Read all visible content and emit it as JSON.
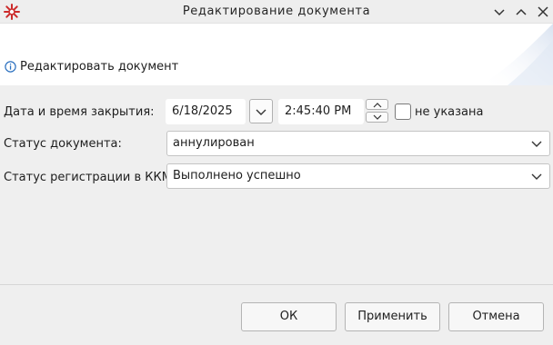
{
  "window": {
    "title": "Редактирование документа",
    "icon": "red-snowflake-logo",
    "controls": [
      "minimize-icon",
      "maximize-icon",
      "close-icon"
    ]
  },
  "header": {
    "icon": "info-icon",
    "text": "Редактировать документ"
  },
  "form": {
    "close_datetime": {
      "label": "Дата и время закрытия:",
      "date_value": "6/18/2025",
      "time_value": "2:45:40 PM",
      "not_specified_label": "не указана",
      "not_specified_checked": false
    },
    "doc_status": {
      "label": "Статус документа:",
      "value": "аннулирован"
    },
    "kkm_status": {
      "label": "Статус регистрации в ККМ:",
      "value": "Выполнено успешно"
    }
  },
  "buttons": {
    "ok": "ОК",
    "apply": "Применить",
    "cancel": "Отмена"
  },
  "colors": {
    "accent_logo": "#cc2a2a",
    "info_icon": "#2a6fbf"
  }
}
